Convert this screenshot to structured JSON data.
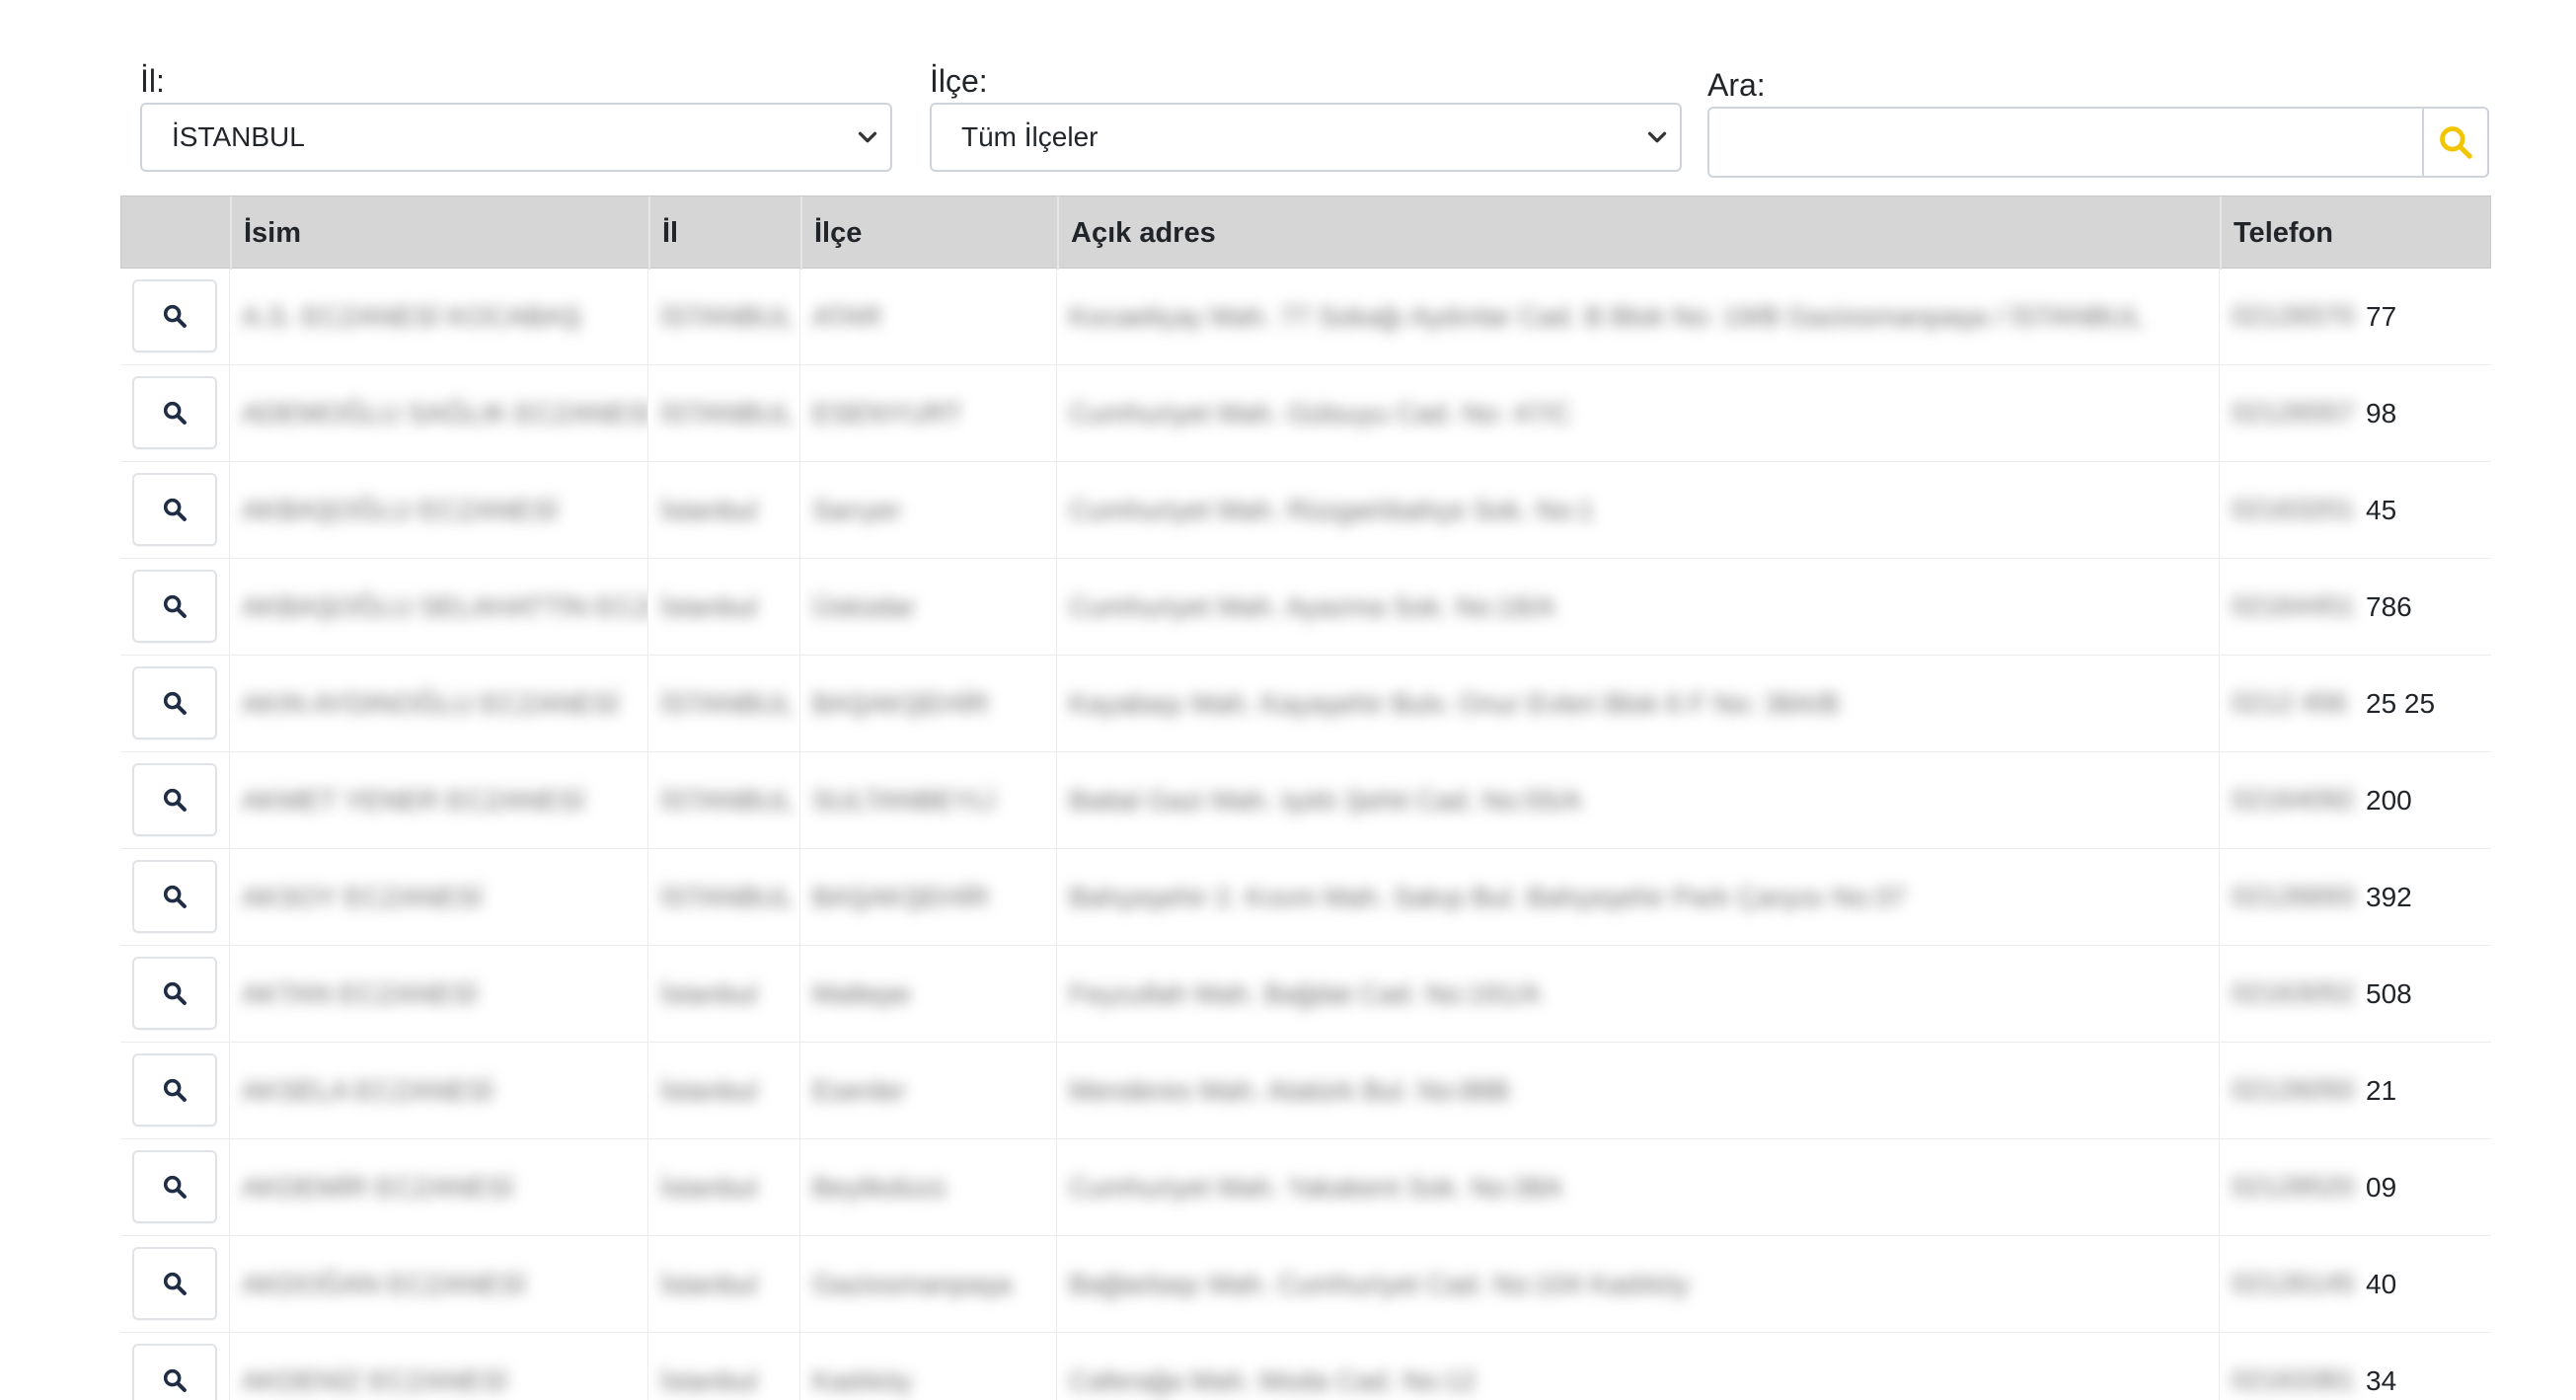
{
  "filters": {
    "il_label": "İl:",
    "il_selected": "İSTANBUL",
    "ilce_label": "İlçe:",
    "ilce_selected": "Tüm İlçeler",
    "ara_label": "Ara:",
    "ara_value": "",
    "search_icon_color": "#f2c500"
  },
  "table": {
    "headers": [
      "",
      "İsim",
      "İl",
      "İlçe",
      "Açık adres",
      "Telefon"
    ],
    "rows": [
      {
        "isim": "A.S. ECZANESİ KOCABAŞ",
        "il": "İSTANBUL",
        "ilce": "ATAR",
        "adres": "Kocaeliçay Mah. 77 Sokağı Aydınlar Cad. B Blok No: 19/B Gaziosmanpaşa / İSTANBUL",
        "tel_hidden": "02126570",
        "tel_tail": "77"
      },
      {
        "isim": "ADEMOĞLU SAĞLIK ECZANESİ",
        "il": "İSTANBUL",
        "ilce": "ESENYURT",
        "adres": "Cumhuriyet Mah. Gülsuyu Cad. No: 47/C",
        "tel_hidden": "02126557",
        "tel_tail": "98"
      },
      {
        "isim": "AKBAŞOĞLU ECZANESİ",
        "il": "İstanbul",
        "ilce": "Sarıyer",
        "adres": "Cumhuriyet Mah. Rüzgarlıbahçe Sok. No:1",
        "tel_hidden": "02163201",
        "tel_tail": "45"
      },
      {
        "isim": "AKBAŞOĞLU SELAHATTİN ECZANESİ",
        "il": "İstanbul",
        "ilce": "Üsküdar",
        "adres": "Cumhuriyet Mah. Ayazma Sok. No:18/A",
        "tel_hidden": "02164451",
        "tel_tail": "786"
      },
      {
        "isim": "AKIN AYDINOĞLU ECZANESİ",
        "il": "İSTANBUL",
        "ilce": "BAŞAKŞEHİR",
        "adres": "Kayabaşı Mah. Kayaşehir Bulv. Onur Evleri Blok 6 F No: 38A/B",
        "tel_hidden": "0212 456",
        "tel_tail": "25 25"
      },
      {
        "isim": "AKMET YENER ECZANESİ",
        "il": "İSTANBUL",
        "ilce": "SULTANBEYLİ",
        "adres": "Battal Gazi Mah. Işıklı Şehit Cad. No:55/A",
        "tel_hidden": "02164092",
        "tel_tail": "200"
      },
      {
        "isim": "AKSOY ECZANESİ",
        "il": "İSTANBUL",
        "ilce": "BAŞAKŞEHİR",
        "adres": "Bahçeşehir 2. Kısım Mah. Sakıp Bul. Bahçeşehir Park Çarşısı No:37",
        "tel_hidden": "02126693",
        "tel_tail": "392"
      },
      {
        "isim": "AKTAN ECZANESİ",
        "il": "İstanbul",
        "ilce": "Maltepe",
        "adres": "Feyzullah Mah. Bağdat Cad. No:191/A",
        "tel_hidden": "02163052",
        "tel_tail": "508"
      },
      {
        "isim": "AKSELA ECZANESİ",
        "il": "İstanbul",
        "ilce": "Esenler",
        "adres": "Menderes Mah. Atatürk Bul. No:88B",
        "tel_hidden": "02126050",
        "tel_tail": "21"
      },
      {
        "isim": "AKDEMİR ECZANESİ",
        "il": "İstanbul",
        "ilce": "Beylikdüzü",
        "adres": "Cumhuriyet Mah. Yakakent Sok. No:38A",
        "tel_hidden": "02128520",
        "tel_tail": "09"
      },
      {
        "isim": "AKDOĞAN ECZANESİ",
        "il": "İstanbul",
        "ilce": "Gaziosmanpaşa",
        "adres": "Bağlarbaşı Mah. Cumhuriyet Cad. No:104 Kadıköy",
        "tel_hidden": "02126145",
        "tel_tail": "40"
      },
      {
        "isim": "AKDENİZ ECZANESİ",
        "il": "İstanbul",
        "ilce": "Kadıköy",
        "adres": "Caferağa Mah. Moda Cad. No:12",
        "tel_hidden": "02163381",
        "tel_tail": "34"
      }
    ]
  }
}
